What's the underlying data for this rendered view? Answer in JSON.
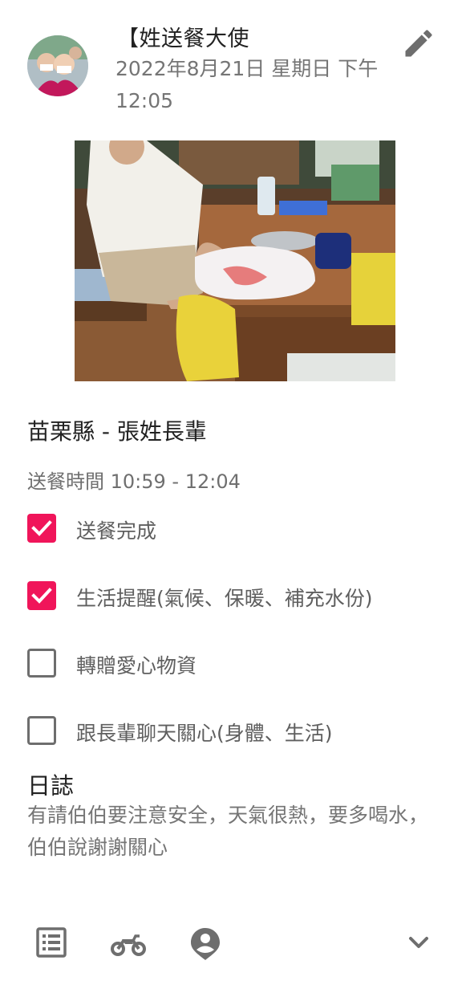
{
  "header": {
    "author": "【姓送餐大使",
    "timestamp": "2022年8月21日 星期日 下午12:05",
    "edit_icon": "pencil-icon"
  },
  "post": {
    "recipient": "苗栗縣 - 張姓長輩",
    "delivery_time": "送餐時間 10:59 - 12:04"
  },
  "tasks": [
    {
      "label": "送餐完成",
      "checked": true
    },
    {
      "label": "生活提醒(氣候、保暖、補充水份)",
      "checked": true
    },
    {
      "label": "轉贈愛心物資",
      "checked": false
    },
    {
      "label": "跟長輩聊天關心(身體、生活)",
      "checked": false
    }
  ],
  "log": {
    "title": "日誌",
    "text": "有請伯伯要注意安全，天氣很熱，要多喝水，伯伯說謝謝關心"
  },
  "bottom_bar": {
    "icons": [
      "list-icon",
      "scooter-icon",
      "person-pin-icon",
      "chevron-down-icon"
    ]
  },
  "colors": {
    "accent": "#f0155a",
    "icon_gray": "#6e6e6e",
    "secondary_text": "#757575"
  }
}
